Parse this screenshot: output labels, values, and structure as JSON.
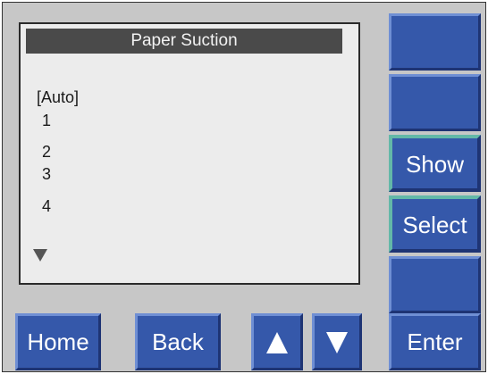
{
  "screen": {
    "title": "Paper Suction",
    "items": [
      "[Auto]",
      "1",
      "2",
      "3",
      "4"
    ],
    "more_indicator_icon": "triangle-down-icon"
  },
  "side_buttons": [
    "",
    "",
    "Show",
    "Select",
    ""
  ],
  "bottom_buttons": {
    "home": "Home",
    "back": "Back",
    "up_icon": "triangle-up-icon",
    "down_icon": "triangle-down-icon",
    "enter": "Enter"
  },
  "colors": {
    "button_blue": "#3558aa",
    "panel_gray": "#c7c7c7",
    "screen_bg": "#ececec",
    "title_bar": "#4a4a4a",
    "active_outline": "#63b8a8"
  }
}
